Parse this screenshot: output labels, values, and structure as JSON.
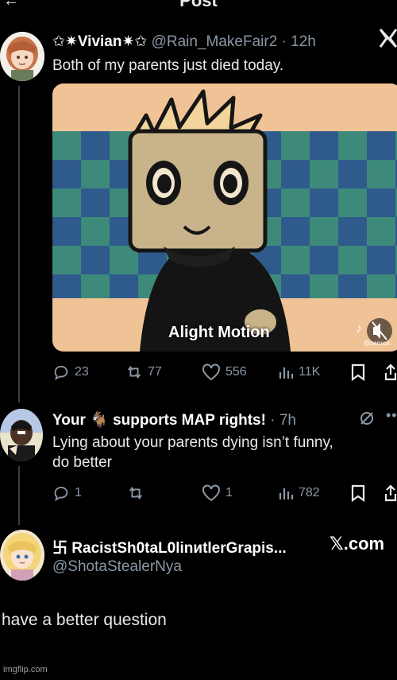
{
  "header": {
    "title": "Post",
    "back_icon": "back-arrow-icon"
  },
  "tweet1": {
    "display_name": "✩✷Vivian✷✩",
    "handle": "@Rain_MakeFair2",
    "time": "· 12h",
    "text": "Both of my parents just died today.",
    "media_overlay": "Alight Motion",
    "media_watermark": "@zamick",
    "stats": {
      "replies": "23",
      "reposts": "77",
      "likes": "556",
      "views": "11K"
    }
  },
  "tweet2": {
    "display_name_part1": "Your",
    "emoji": "🐐",
    "display_name_part2": "supports MAP rights!",
    "time": "· 7h",
    "text_line1": "Lying about your parents dying isn’t funny,",
    "text_line2": "do better",
    "stats": {
      "replies": "1",
      "reposts": "",
      "likes": "1",
      "views": "782"
    }
  },
  "tweet3": {
    "symbol": "卐",
    "display_name": "RacistSh0taL0linиtlerGrapis...",
    "handle": "@ShotaStealerNya",
    "xcom": "𝕏.com"
  },
  "bottom_text": "have a better question",
  "watermark": "imgflip.com",
  "colors": {
    "background": "#000000",
    "muted": "#8b98a5",
    "text": "#e7e9ea"
  }
}
